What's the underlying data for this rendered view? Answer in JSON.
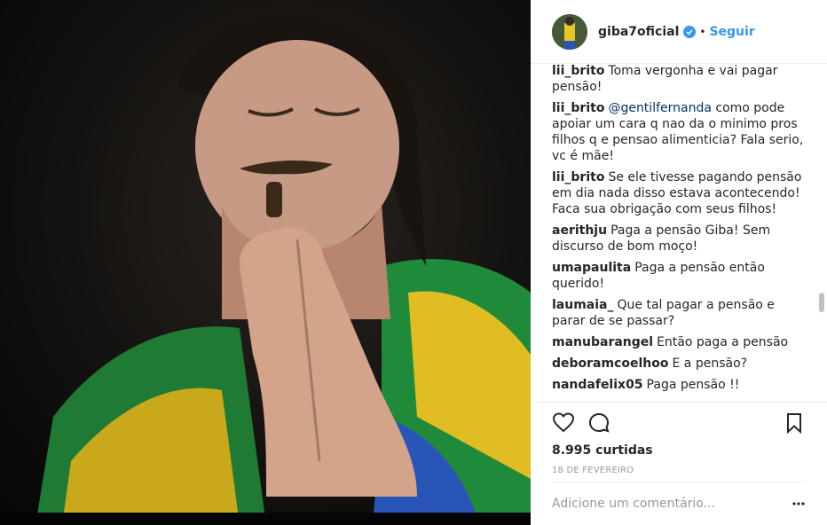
{
  "post": {
    "username": "giba7oficial",
    "dot": "•",
    "follow_label": "Seguir",
    "likes": "8.995 curtidas",
    "date": "18 de fevereiro",
    "comment_placeholder": "Adicione um comentário..."
  },
  "comments": [
    {
      "user": "lii_brito",
      "mention": "",
      "text": "Toma vergonha e vai pagar pensão!"
    },
    {
      "user": "lii_brito",
      "mention": "@gentilfernanda",
      "text": "como pode apoiar um cara q nao da o minimo pros filhos q e pensao alimenticia? Fala serio, vc é mãe!"
    },
    {
      "user": "lii_brito",
      "mention": "",
      "text": "Se ele tivesse pagando pensão em dia nada disso estava acontecendo! Faca sua obrigação com seus filhos!"
    },
    {
      "user": "aerithju",
      "mention": "",
      "text": "Paga a pensão Giba! Sem discurso de bom moço!"
    },
    {
      "user": "umapaulita",
      "mention": "",
      "text": "Paga a pensão então querido!"
    },
    {
      "user": "laumaia_",
      "mention": "",
      "text": "Que tal pagar a pensão e parar de se passar?"
    },
    {
      "user": "manubarangel",
      "mention": "",
      "text": "Então paga a pensão"
    },
    {
      "user": "deboramcoelhoo",
      "mention": "",
      "text": "E a pensão?"
    },
    {
      "user": "nandafelix05",
      "mention": "",
      "text": "Paga pensão !!"
    }
  ],
  "colors": {
    "accent": "#3897f0",
    "flag_green": "#1f8a3a",
    "flag_yellow": "#e8c21a",
    "flag_blue": "#2a55b8"
  },
  "icons": {
    "verified": "verified-badge-icon",
    "like": "heart-icon",
    "comment": "comment-bubble-icon",
    "save": "bookmark-icon",
    "more": "more-options-icon"
  }
}
